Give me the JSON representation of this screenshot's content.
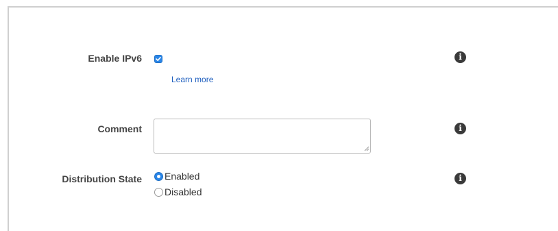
{
  "form": {
    "ipv6": {
      "label": "Enable IPv6",
      "checked": true,
      "learn_more": "Learn more",
      "info_icon": "info-icon"
    },
    "comment": {
      "label": "Comment",
      "value": "",
      "info_icon": "info-icon"
    },
    "distribution_state": {
      "label": "Distribution State",
      "options": [
        "Enabled",
        "Disabled"
      ],
      "selected": "Enabled",
      "info_icon": "info-icon"
    }
  },
  "colors": {
    "accent": "#2a86e8",
    "link": "#1f5fbf",
    "info_icon": "#3a3a3a"
  }
}
